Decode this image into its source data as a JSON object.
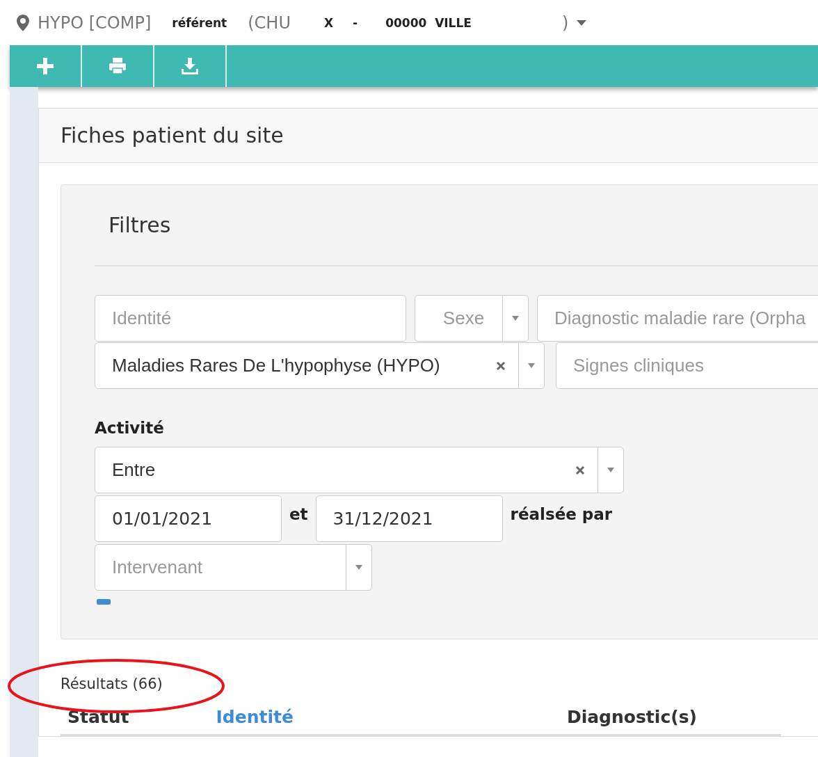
{
  "location": {
    "site": "HYPO [COMP]",
    "role": "référent",
    "open": "(CHU",
    "code": "X",
    "dash": "-",
    "city": "00000  VILLE",
    "close": ")"
  },
  "toolbar": {
    "buttons": [
      {
        "kind": "add"
      },
      {
        "kind": "print"
      },
      {
        "kind": "download"
      }
    ]
  },
  "panel": {
    "title": "Fiches patient du site"
  },
  "filters": {
    "title": "Filtres",
    "fields": [
      {
        "kind": "text",
        "placeholder": "Identité"
      },
      {
        "kind": "select",
        "placeholder": "Sexe",
        "clearable": false
      },
      {
        "kind": "text",
        "placeholder": "Diagnostic maladie rare (Orpha"
      },
      {
        "kind": "select",
        "value": "Maladies Rares De L'hypophyse (HYPO)",
        "clearable": true
      },
      {
        "kind": "text",
        "placeholder": "Signes cliniques"
      }
    ],
    "activity": {
      "label": "Activité",
      "mode": {
        "kind": "select",
        "value": "Entre",
        "clearable": true
      },
      "from": "01/01/2021",
      "between": "et",
      "to": "31/12/2021",
      "by_label": "réalsée par",
      "actor": {
        "kind": "select",
        "placeholder": "Intervenant",
        "clearable": false
      }
    }
  },
  "results": {
    "count": "Résultats (66)",
    "columns": [
      {
        "label": "Statut",
        "selected": false
      },
      {
        "label": "Identité",
        "selected": true
      },
      {
        "label": "Diagnostic(s)",
        "selected": false
      }
    ]
  }
}
